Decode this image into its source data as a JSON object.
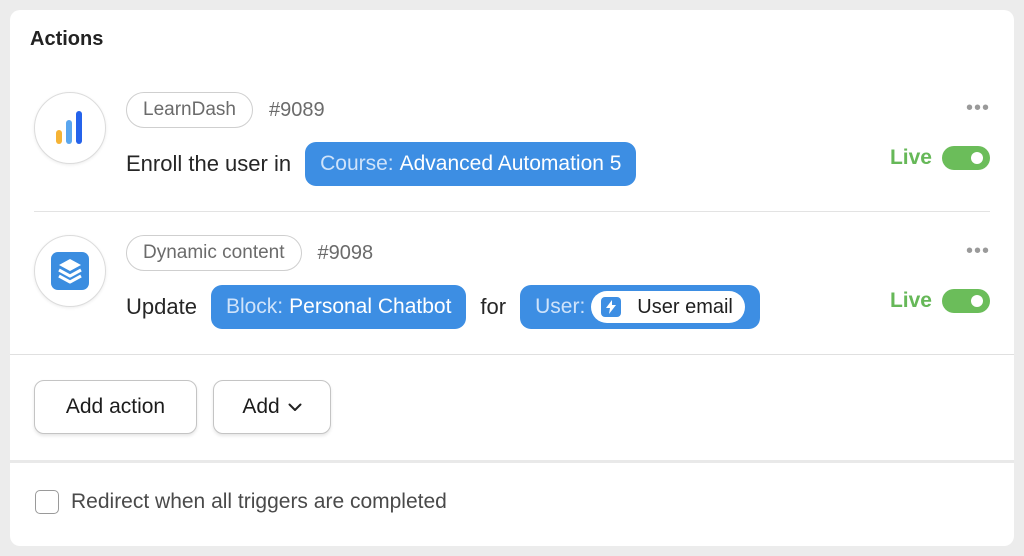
{
  "panel": {
    "title": "Actions"
  },
  "actions": [
    {
      "app": "LearnDash",
      "id": "#9089",
      "logo_icon": "bar-chart-icon",
      "sentence": {
        "prefix": "Enroll the user in",
        "chip_key": "Course:",
        "chip_value": "Advanced Automation 5"
      },
      "status": "Live",
      "menu": "•••"
    },
    {
      "app": "Dynamic content",
      "id": "#9098",
      "logo_icon": "layers-icon",
      "sentence": {
        "prefix": "Update",
        "chip_key": "Block:",
        "chip_value": "Personal Chatbot",
        "joiner": "for",
        "chip2_key": "User:",
        "chip2_sub": "User email"
      },
      "status": "Live",
      "menu": "•••"
    }
  ],
  "buttons": {
    "add_action": "Add action",
    "add": "Add"
  },
  "redirect": {
    "label": "Redirect when all triggers are completed",
    "checked": false
  },
  "colors": {
    "chip": "#3d8ee3",
    "live": "#66b858",
    "toggle": "#6bbd5a"
  }
}
